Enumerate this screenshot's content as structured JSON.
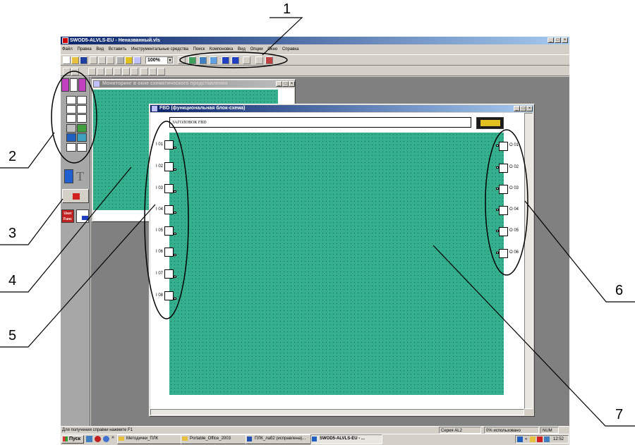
{
  "app": {
    "title": "SWOD5-ALVLS-EU - Неназванный.vls",
    "menu": [
      "Файл",
      "Правка",
      "Вид",
      "Вставить",
      "Инструментальные средства",
      "Поиск",
      "Компоновка",
      "Вид",
      "Опции",
      "Окно",
      "Справка"
    ],
    "zoom_value": "100%",
    "window_controls": [
      "_",
      "□",
      "×"
    ]
  },
  "monitor_window": {
    "title": "Мониторинг в окне схематического представления",
    "controls": [
      "_",
      "□",
      "×"
    ]
  },
  "fbd_window": {
    "title": "FBD (функциональная блок-схема)",
    "header_field": "ЗАГОЛОВОК FBD",
    "controls": [
      "_",
      "□",
      "×"
    ],
    "inputs": [
      "I 01",
      "I 02",
      "I 03",
      "I 04",
      "I 05",
      "I 06",
      "I 07",
      "I 08"
    ],
    "outputs": [
      "O 01",
      "O 02",
      "O 03",
      "O 04",
      "O 05",
      "O 06"
    ]
  },
  "palette": {
    "user_func_label": "User Func"
  },
  "status_bar": {
    "help_text": "Для получения справки нажмите F1",
    "series": "Серия AL2",
    "usage": "0% использовано",
    "num": "NUM"
  },
  "taskbar": {
    "start_label": "Пуск",
    "tasks": [
      "Методички_ПЛК",
      "Portable_Office_2003",
      "ПЛК_лаб2 (исправлена)...",
      "SWOD5-ALVLS-EU - ..."
    ],
    "clock": "12:52"
  },
  "callouts": [
    "1",
    "2",
    "3",
    "4",
    "5",
    "6",
    "7"
  ],
  "colors": {
    "canvas": "#35b08e",
    "titlebar": "#0a246a",
    "face": "#d4d0c8",
    "workspace": "#808080"
  }
}
